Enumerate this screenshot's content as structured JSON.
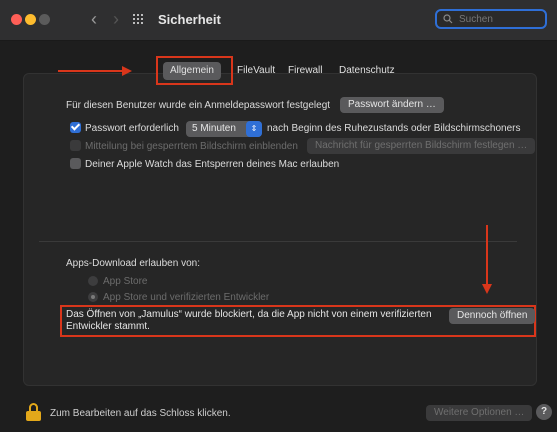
{
  "window": {
    "title": "Sicherheit",
    "search_placeholder": "Suchen"
  },
  "tabs": [
    {
      "label": "Allgemein",
      "active": true
    },
    {
      "label": "FileVault",
      "active": false
    },
    {
      "label": "Firewall",
      "active": false
    },
    {
      "label": "Datenschutz",
      "active": false
    }
  ],
  "general": {
    "password_set_text": "Für diesen Benutzer wurde ein Anmeldepasswort festgelegt",
    "change_password_button": "Passwort ändern …",
    "require_password": {
      "checked": true,
      "label_before": "Passwort erforderlich",
      "select_value": "5 Minuten",
      "label_after": "nach Beginn des Ruhezustands oder Bildschirmschoners"
    },
    "show_message": {
      "checked": false,
      "disabled": true,
      "label": "Mitteilung bei gesperrtem Bildschirm einblenden",
      "button": "Nachricht für gesperrten Bildschirm festlegen …"
    },
    "apple_watch": {
      "checked": false,
      "label": "Deiner Apple Watch das Entsperren deines Mac erlauben"
    }
  },
  "downloads": {
    "heading": "Apps-Download erlauben von:",
    "options": [
      {
        "label": "App Store",
        "selected": false
      },
      {
        "label": "App Store und verifizierten Entwickler",
        "selected": true
      }
    ],
    "blocked_message": "Das Öffnen von „Jamulus“ wurde blockiert, da die App nicht von einem verifizierten Entwickler stammt.",
    "open_anyway_button": "Dennoch öffnen"
  },
  "footer": {
    "lock_text": "Zum Bearbeiten auf das Schloss klicken.",
    "advanced_button": "Weitere Optionen …",
    "help_label": "?"
  },
  "colors": {
    "accent": "#2f6fd6",
    "annotation": "#d9361b",
    "lock": "#e3a81a"
  }
}
